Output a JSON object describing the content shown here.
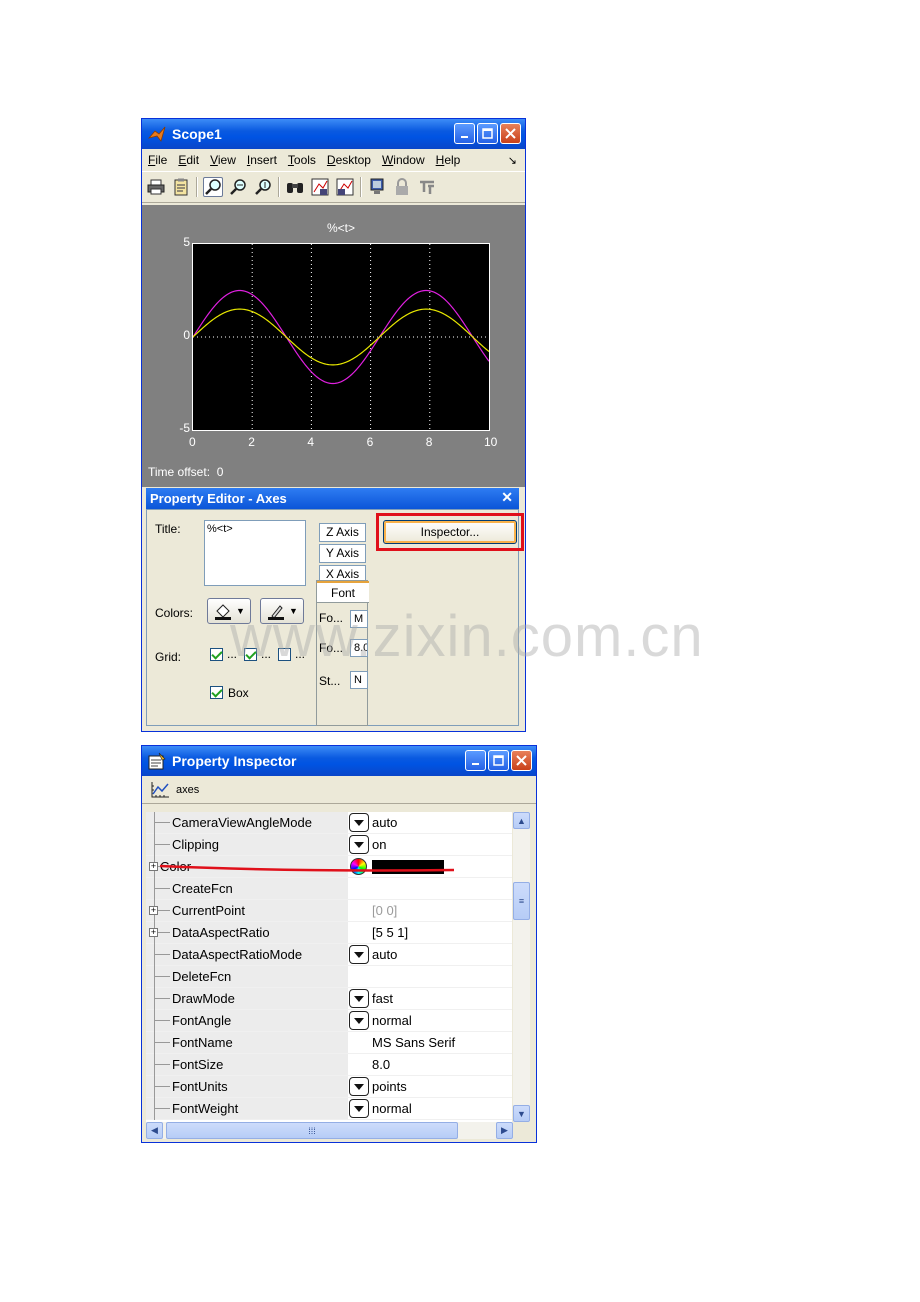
{
  "scope_window": {
    "title": "Scope1",
    "menu": [
      {
        "label": "File",
        "u": "F",
        "rest": "ile"
      },
      {
        "label": "Edit",
        "u": "E",
        "rest": "dit"
      },
      {
        "label": "View",
        "u": "V",
        "rest": "iew"
      },
      {
        "label": "Insert",
        "u": "I",
        "rest": "nsert"
      },
      {
        "label": "Tools",
        "u": "T",
        "rest": "ools"
      },
      {
        "label": "Desktop",
        "u": "D",
        "rest": "esktop"
      },
      {
        "label": "Window",
        "u": "W",
        "rest": "indow"
      },
      {
        "label": "Help",
        "u": "H",
        "rest": "elp"
      }
    ],
    "axes_title": "%<t>",
    "time_offset_label": "Time offset:",
    "time_offset_value": "0"
  },
  "chart_data": {
    "type": "line",
    "title": "%<t>",
    "xlim": [
      0,
      10
    ],
    "ylim": [
      -5,
      5
    ],
    "x_ticks": [
      "0",
      "2",
      "4",
      "6",
      "8",
      "10"
    ],
    "y_ticks": [
      "5",
      "0",
      "-5"
    ],
    "grid": true,
    "series": [
      {
        "color": "#e020e0",
        "amplitude": 2.5,
        "period": 6.3
      },
      {
        "color": "#e8e800",
        "amplitude": 1.5,
        "period": 6.3
      }
    ]
  },
  "property_editor": {
    "title": "Property Editor - Axes",
    "close_label": "✕",
    "title_label": "Title:",
    "title_value": "%<t>",
    "z_axis_tab": "Z Axis",
    "y_axis_tab": "Y Axis",
    "x_axis_tab": "X Axis",
    "font_tab": "Font",
    "inspector_button": "Inspector...",
    "colors_label": "Colors:",
    "grid_label": "Grid:",
    "grid_dots": "...",
    "box_label": "Box",
    "font_rows": [
      {
        "label": "Fo...",
        "value": "M"
      },
      {
        "label": "Fo...",
        "value": "8.0"
      },
      {
        "label": "St...",
        "value": "N"
      }
    ]
  },
  "property_inspector": {
    "title": "Property Inspector",
    "object_label": "axes",
    "rows": [
      {
        "name": "CameraViewAngleMode",
        "value": "auto",
        "dropdown": true
      },
      {
        "name": "Clipping",
        "value": "on",
        "dropdown": true
      },
      {
        "name": "Color",
        "value": "",
        "color_swatch": "#000000",
        "expandable": true
      },
      {
        "name": "CreateFcn",
        "value": ""
      },
      {
        "name": "CurrentPoint",
        "value": "[0 0]",
        "expandable": true,
        "gray": true
      },
      {
        "name": "DataAspectRatio",
        "value": "[5 5 1]",
        "expandable": true
      },
      {
        "name": "DataAspectRatioMode",
        "value": "auto",
        "dropdown": true
      },
      {
        "name": "DeleteFcn",
        "value": ""
      },
      {
        "name": "DrawMode",
        "value": "fast",
        "dropdown": true
      },
      {
        "name": "FontAngle",
        "value": "normal",
        "dropdown": true
      },
      {
        "name": "FontName",
        "value": "MS Sans Serif"
      },
      {
        "name": "FontSize",
        "value": "8.0"
      },
      {
        "name": "FontUnits",
        "value": "points",
        "dropdown": true
      },
      {
        "name": "FontWeight",
        "value": "normal",
        "dropdown": true
      }
    ]
  },
  "watermark": "www.zixin.com.cn",
  "colors": {
    "highlight_red": "#e0101a",
    "xp_blue": "#0054e3"
  }
}
